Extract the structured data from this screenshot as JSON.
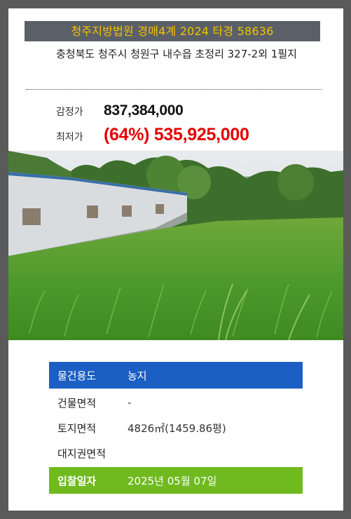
{
  "auction": {
    "court_case": "청주지방법원 경매4계 2024 타경 58636",
    "address": "충청북도 청주시 청원구 내수읍 초정리 327-2외 1필지"
  },
  "prices": {
    "appraisal_label": "감정가",
    "appraisal_value": "837,384,000",
    "minimum_label": "최저가",
    "minimum_value": "(64%) 535,925,000"
  },
  "details": {
    "usage_label": "물건용도",
    "usage_value": "농지",
    "building_area_label": "건물면적",
    "building_area_value": "-",
    "land_area_label": "토지면적",
    "land_area_value": "4826㎡(1459.86평)",
    "land_right_area_label": "대지권면적",
    "land_right_area_value": "",
    "bid_date_label": "입찰일자",
    "bid_date_value": "2025년 05월 07일"
  },
  "colors": {
    "banner_background": "#5b6068",
    "banner_text": "#f2c200",
    "minimum_price": "#e60000",
    "usage_row": "#1b5ec4",
    "bid_row": "#6fba1f"
  }
}
